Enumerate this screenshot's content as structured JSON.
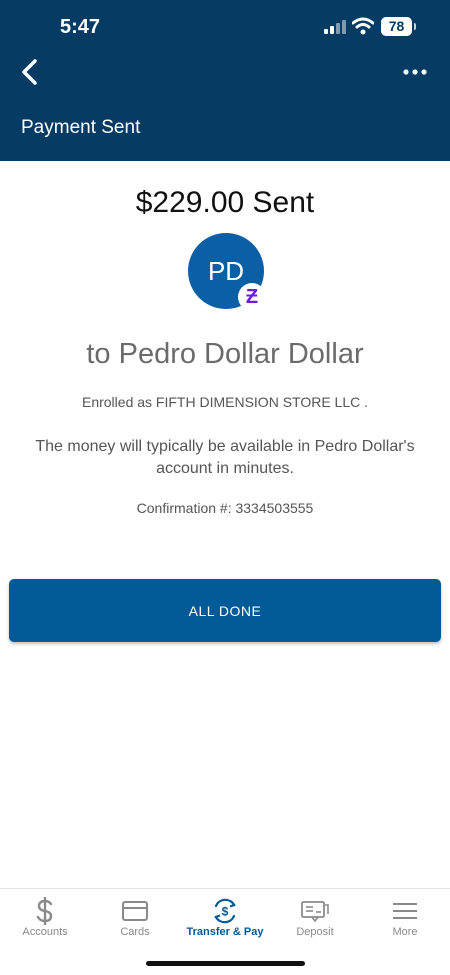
{
  "status_bar": {
    "time": "5:47",
    "battery": "78"
  },
  "header": {
    "title": "Payment Sent",
    "back_icon": "chevron-left-icon",
    "more_icon": "ellipsis-icon"
  },
  "payment": {
    "amount_text": "$229.00 Sent",
    "avatar_initials": "PD",
    "badge_symbol": "Ƶ",
    "recipient_text": "to Pedro Dollar Dollar",
    "enrolled_text": "Enrolled as FIFTH DIMENSION STORE LLC .",
    "availability_text": "The money will typically be available in Pedro Dollar's account in minutes.",
    "confirmation_text": "Confirmation #: 3334503555",
    "done_label": "ALL DONE"
  },
  "tabbar": {
    "items": [
      {
        "label": "Accounts",
        "icon": "dollar-icon"
      },
      {
        "label": "Cards",
        "icon": "card-icon"
      },
      {
        "label": "Transfer & Pay",
        "icon": "transfer-icon"
      },
      {
        "label": "Deposit",
        "icon": "check-deposit-icon"
      },
      {
        "label": "More",
        "icon": "menu-icon"
      }
    ],
    "active_label": "Transfer & Pay"
  },
  "colors": {
    "header_bg": "#063c63",
    "primary_button": "#005a98",
    "avatar_bg": "#0b5fa5",
    "zelle_purple": "#6d1ed4"
  }
}
